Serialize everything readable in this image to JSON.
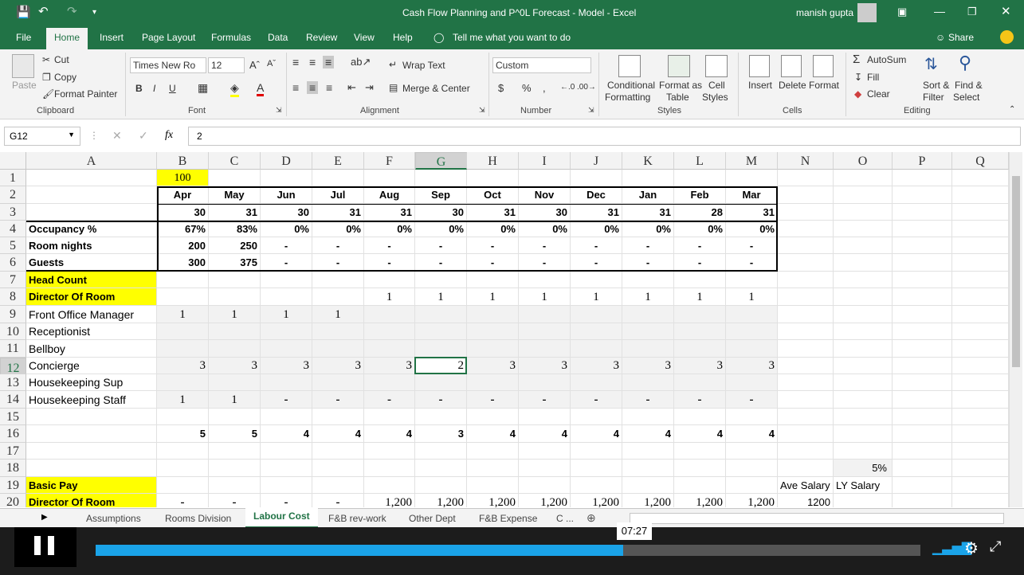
{
  "window": {
    "title": "Cash Flow Planning and P^0L Forecast - Model  -  Excel",
    "user": "manish gupta"
  },
  "ribbon_tabs": [
    "File",
    "Home",
    "Insert",
    "Page Layout",
    "Formulas",
    "Data",
    "Review",
    "View",
    "Help"
  ],
  "tell_me": "Tell me what you want to do",
  "share": "Share",
  "clipboard": {
    "paste": "Paste",
    "cut": "Cut",
    "copy": "Copy",
    "format_painter": "Format Painter",
    "label": "Clipboard"
  },
  "font": {
    "name": "Times New Ro",
    "size": "12",
    "label": "Font",
    "bold": "B",
    "italic": "I",
    "underline": "U"
  },
  "alignment": {
    "wrap": "Wrap Text",
    "merge": "Merge & Center",
    "label": "Alignment"
  },
  "number": {
    "format": "Custom",
    "currency": "$",
    "percent": "%",
    "comma": ",",
    "label": "Number"
  },
  "styles": {
    "cond1": "Conditional",
    "cond2": "Formatting",
    "fat1": "Format as",
    "fat2": "Table",
    "cs1": "Cell",
    "cs2": "Styles",
    "label": "Styles"
  },
  "cells": {
    "insert": "Insert",
    "delete": "Delete",
    "format": "Format",
    "label": "Cells"
  },
  "editing": {
    "autosum": "AutoSum",
    "fill": "Fill",
    "clear": "Clear",
    "sort1": "Sort &",
    "sort2": "Filter",
    "find1": "Find &",
    "find2": "Select",
    "label": "Editing"
  },
  "formula_bar": {
    "name_box": "G12",
    "fx": "fx",
    "value": "2"
  },
  "columns": [
    "A",
    "B",
    "C",
    "D",
    "E",
    "F",
    "G",
    "H",
    "I",
    "J",
    "K",
    "L",
    "M",
    "N",
    "O",
    "P",
    "Q"
  ],
  "rows": [
    "1",
    "2",
    "3",
    "4",
    "5",
    "6",
    "7",
    "8",
    "9",
    "10",
    "11",
    "12",
    "13",
    "14",
    "15",
    "16",
    "17",
    "18",
    "19",
    "20"
  ],
  "sheet_rows": [
    {
      "label": "",
      "vals": [
        "100",
        "",
        "",
        "",
        "",
        "",
        "",
        "",
        "",
        "",
        "",
        ""
      ],
      "n": "",
      "o": ""
    },
    {
      "label": "",
      "vals": [
        "Apr",
        "May",
        "Jun",
        "Jul",
        "Aug",
        "Sep",
        "Oct",
        "Nov",
        "Dec",
        "Jan",
        "Feb",
        "Mar"
      ],
      "n": "",
      "o": ""
    },
    {
      "label": "",
      "vals": [
        "30",
        "31",
        "30",
        "31",
        "31",
        "30",
        "31",
        "30",
        "31",
        "31",
        "28",
        "31"
      ],
      "n": "",
      "o": ""
    },
    {
      "label": "Occupancy %",
      "vals": [
        "67%",
        "83%",
        "0%",
        "0%",
        "0%",
        "0%",
        "0%",
        "0%",
        "0%",
        "0%",
        "0%",
        "0%"
      ],
      "n": "",
      "o": ""
    },
    {
      "label": "Room nights",
      "vals": [
        "200",
        "250",
        "-",
        "-",
        "-",
        "-",
        "-",
        "-",
        "-",
        "-",
        "-",
        "-"
      ],
      "n": "",
      "o": ""
    },
    {
      "label": "Guests",
      "vals": [
        "300",
        "375",
        "-",
        "-",
        "-",
        "-",
        "-",
        "-",
        "-",
        "-",
        "-",
        "-"
      ],
      "n": "",
      "o": ""
    },
    {
      "label": "Head Count",
      "vals": [
        "",
        "",
        "",
        "",
        "",
        "",
        "",
        "",
        "",
        "",
        "",
        ""
      ],
      "n": "",
      "o": ""
    },
    {
      "label": "Director Of Room",
      "vals": [
        "",
        "",
        "",
        "",
        "1",
        "1",
        "1",
        "1",
        "1",
        "1",
        "1",
        "1"
      ],
      "n": "",
      "o": ""
    },
    {
      "label": "Front Office Manager",
      "vals": [
        "1",
        "1",
        "1",
        "1",
        "",
        "",
        "",
        "",
        "",
        "",
        "",
        ""
      ],
      "n": "",
      "o": ""
    },
    {
      "label": "Receptionist",
      "vals": [
        "",
        "",
        "",
        "",
        "",
        "",
        "",
        "",
        "",
        "",
        "",
        ""
      ],
      "n": "",
      "o": ""
    },
    {
      "label": "Bellboy",
      "vals": [
        "",
        "",
        "",
        "",
        "",
        "",
        "",
        "",
        "",
        "",
        "",
        ""
      ],
      "n": "",
      "o": ""
    },
    {
      "label": "Concierge",
      "vals": [
        "3",
        "3",
        "3",
        "3",
        "3",
        "2",
        "3",
        "3",
        "3",
        "3",
        "3",
        "3"
      ],
      "n": "",
      "o": ""
    },
    {
      "label": "Housekeeping Sup",
      "vals": [
        "",
        "",
        "",
        "",
        "",
        "",
        "",
        "",
        "",
        "",
        "",
        ""
      ],
      "n": "",
      "o": ""
    },
    {
      "label": "Housekeeping Staff",
      "vals": [
        "1",
        "1",
        "-",
        "-",
        "-",
        "-",
        "-",
        "-",
        "-",
        "-",
        "-",
        "-"
      ],
      "n": "",
      "o": ""
    },
    {
      "label": "",
      "vals": [
        "",
        "",
        "",
        "",
        "",
        "",
        "",
        "",
        "",
        "",
        "",
        ""
      ],
      "n": "",
      "o": ""
    },
    {
      "label": "",
      "vals": [
        "5",
        "5",
        "4",
        "4",
        "4",
        "3",
        "4",
        "4",
        "4",
        "4",
        "4",
        "4"
      ],
      "n": "",
      "o": ""
    },
    {
      "label": "",
      "vals": [
        "",
        "",
        "",
        "",
        "",
        "",
        "",
        "",
        "",
        "",
        "",
        ""
      ],
      "n": "",
      "o": ""
    },
    {
      "label": "",
      "vals": [
        "",
        "",
        "",
        "",
        "",
        "",
        "",
        "",
        "",
        "",
        "",
        ""
      ],
      "n": "",
      "o": "5%"
    },
    {
      "label": "Basic Pay",
      "vals": [
        "",
        "",
        "",
        "",
        "",
        "",
        "",
        "",
        "",
        "",
        "",
        ""
      ],
      "n": "Ave Salary",
      "o": "LY Salary"
    },
    {
      "label": "Director Of Room",
      "vals": [
        "-",
        "-",
        "-",
        "-",
        "1,200",
        "1,200",
        "1,200",
        "1,200",
        "1,200",
        "1,200",
        "1,200",
        "1,200"
      ],
      "n": "1200",
      "o": ""
    }
  ],
  "sheet_tabs": [
    "Assumptions",
    "Rooms Division",
    "Labour Cost",
    "F&B rev-work",
    "Other Dept",
    "F&B Expense",
    "C ..."
  ],
  "video": {
    "time": "07:27",
    "progress": 0.64
  },
  "colors": {
    "excel_green": "#217346",
    "yellow": "#ffff00",
    "selection": "#217346"
  }
}
